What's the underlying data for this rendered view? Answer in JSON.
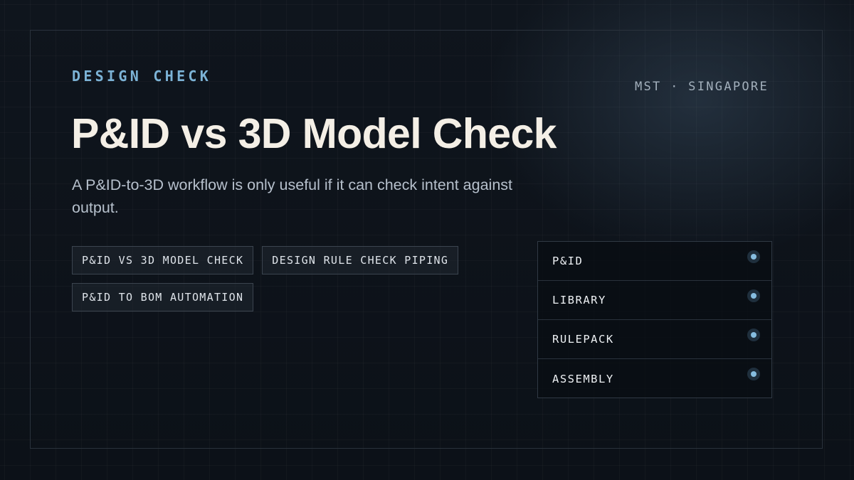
{
  "header": {
    "eyebrow": "DESIGN CHECK",
    "location": "MST · SINGAPORE",
    "title": "P&ID vs 3D Model Check",
    "subtitle": "A P&ID-to-3D workflow is only useful if it can check intent against output."
  },
  "tags": [
    {
      "label": "P&ID VS 3D MODEL CHECK"
    },
    {
      "label": "DESIGN RULE CHECK PIPING"
    },
    {
      "label": "P&ID TO BOM AUTOMATION"
    }
  ],
  "panel": {
    "rows": [
      {
        "label": "P&ID",
        "status": "active"
      },
      {
        "label": "LIBRARY",
        "status": "active"
      },
      {
        "label": "RULEPACK",
        "status": "active"
      },
      {
        "label": "ASSEMBLY",
        "status": "active"
      }
    ]
  },
  "colors": {
    "accent": "#7cb3d6",
    "status_dot": "#86bde0",
    "title": "#f4efe6",
    "background": "#0d1219"
  },
  "icons": {
    "status": "status-dot-icon"
  }
}
